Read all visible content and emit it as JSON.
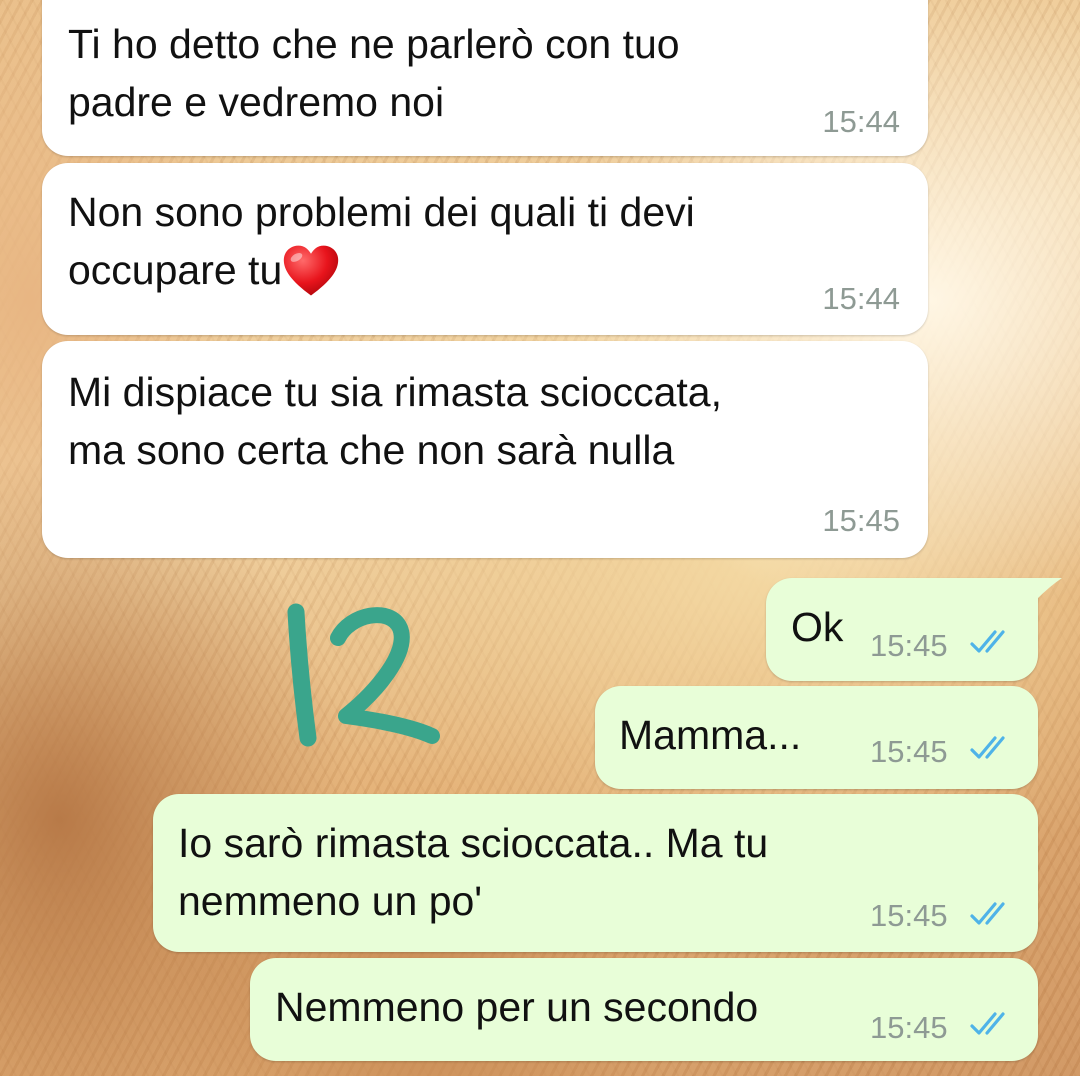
{
  "messages": [
    {
      "direction": "in",
      "text": "Ti ho detto che ne parlerò con tuo\npadre e vedremo noi",
      "time": "15:44"
    },
    {
      "direction": "in",
      "text": "Non sono problemi dei quali ti devi\noccupare tu",
      "emoji": "red-heart",
      "time": "15:44"
    },
    {
      "direction": "in",
      "text": "Mi dispiace tu sia rimasta scioccata,\nma sono certa che non sarà nulla",
      "time": "15:45"
    },
    {
      "direction": "out",
      "text": "Ok",
      "time": "15:45",
      "status": "double-check-read"
    },
    {
      "direction": "out",
      "text": "Mamma...",
      "time": "15:45",
      "status": "double-check-read"
    },
    {
      "direction": "out",
      "text": "Io sarò rimasta scioccata.. Ma tu\nnemmeno un po'",
      "time": "15:45",
      "status": "double-check-read"
    },
    {
      "direction": "out",
      "text": "Nemmeno per un secondo",
      "time": "15:45",
      "status": "double-check-read"
    }
  ],
  "annotation": {
    "text": "12",
    "color": "#3aa58c"
  },
  "colors": {
    "incoming_bubble": "#ffffff",
    "outgoing_bubble": "#e8fed8",
    "read_ticks": "#4fb3e8",
    "timestamp": "#8e9a94"
  }
}
